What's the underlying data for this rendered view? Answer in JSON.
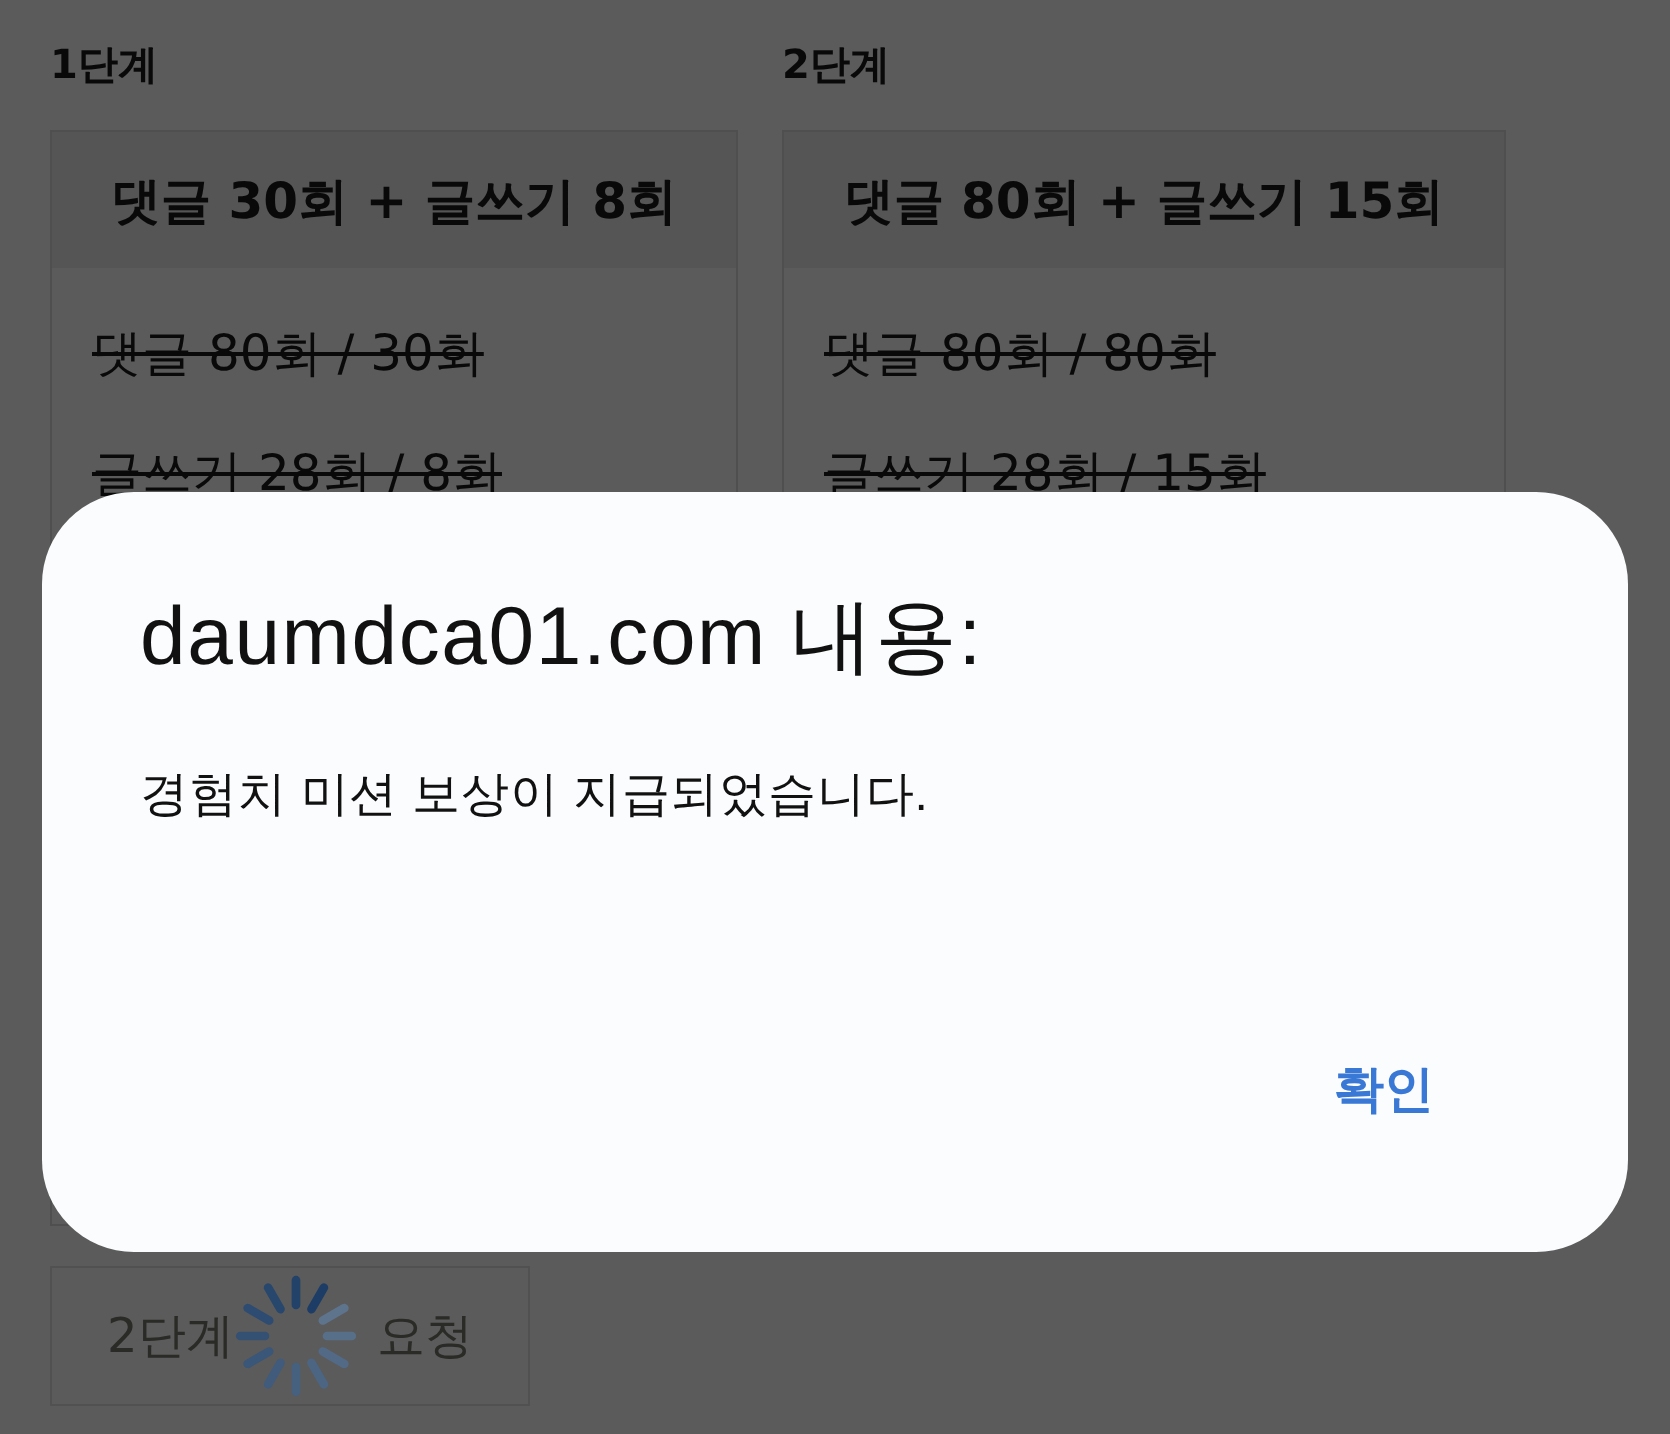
{
  "stages": [
    {
      "label": "1단계",
      "title": "댓글 30회 + 글쓰기 8회",
      "rows": [
        {
          "text": "댓글 80회 / 30회",
          "done": true
        },
        {
          "text": "글쓰기 28회 / 8회",
          "done": true
        }
      ]
    },
    {
      "label": "2단계",
      "title": "댓글 80회 + 글쓰기 15회",
      "rows": [
        {
          "text": "댓글 80회 / 80회",
          "done": true
        },
        {
          "text": "글쓰기 28회 / 15회",
          "done": true
        }
      ]
    }
  ],
  "request_button": {
    "label": "2단계 요청",
    "disabled": true,
    "loading": true
  },
  "dialog": {
    "title": "daumdca01.com 내용:",
    "message": "경험치 미션 보상이 지급되었습니다.",
    "buttons": [
      {
        "label": "확인"
      }
    ]
  }
}
